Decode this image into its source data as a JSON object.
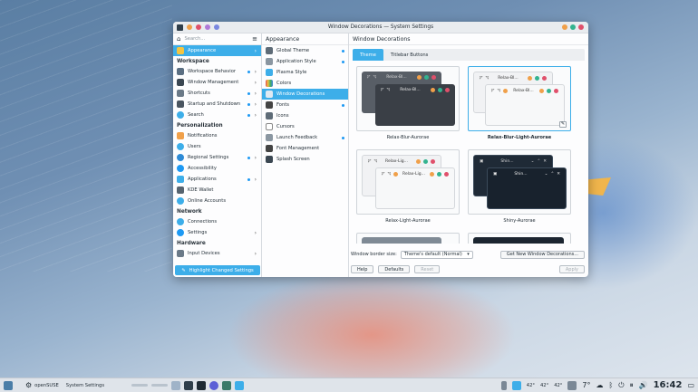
{
  "window": {
    "title": "Window Decorations — System Settings"
  },
  "sidebar": {
    "search_placeholder": "Search...",
    "items": [
      {
        "label": "Appearance"
      },
      {
        "label": "Workspace Behavior"
      },
      {
        "label": "Window Management"
      },
      {
        "label": "Shortcuts"
      },
      {
        "label": "Startup and Shutdown"
      },
      {
        "label": "Search"
      },
      {
        "label": "Notifications"
      },
      {
        "label": "Users"
      },
      {
        "label": "Regional Settings"
      },
      {
        "label": "Accessibility"
      },
      {
        "label": "Applications"
      },
      {
        "label": "KDE Wallet"
      },
      {
        "label": "Online Accounts"
      },
      {
        "label": "Connections"
      },
      {
        "label": "Settings"
      },
      {
        "label": "Input Devices"
      }
    ],
    "categories": [
      "Workspace",
      "Personalization",
      "Network",
      "Hardware"
    ],
    "footer_label": "Highlight Changed Settings"
  },
  "middle": {
    "header": "Appearance",
    "items": [
      {
        "label": "Global Theme"
      },
      {
        "label": "Application Style"
      },
      {
        "label": "Plasma Style"
      },
      {
        "label": "Colors"
      },
      {
        "label": "Window Decorations"
      },
      {
        "label": "Fonts"
      },
      {
        "label": "Icons"
      },
      {
        "label": "Cursors"
      },
      {
        "label": "Launch Feedback"
      },
      {
        "label": "Font Management"
      },
      {
        "label": "Splash Screen"
      }
    ]
  },
  "content": {
    "header": "Window Decorations",
    "tabs": [
      "Theme",
      "Titlebar Buttons"
    ],
    "themes": [
      {
        "name": "Relax-Blur-Aurorae",
        "preview_title": "Relax-Bl..."
      },
      {
        "name": "Relax-Blur-Light-Aurorae",
        "preview_title": "Relax-Bl..."
      },
      {
        "name": "Relax-Light-Aurorae",
        "preview_title": "Relax-Lig..."
      },
      {
        "name": "Shiny-Aurorae",
        "preview_title": "Shin..."
      }
    ],
    "border_size_label": "Window border size:",
    "border_size_value": "Theme's default (Normal)",
    "get_new_label": "Get New Window Decorations...",
    "help_label": "Help",
    "defaults_label": "Defaults",
    "reset_label": "Reset",
    "apply_label": "Apply"
  },
  "taskbar": {
    "distro": "openSUSE",
    "active_app": "System Settings",
    "temps": [
      "42°",
      "42°",
      "42°"
    ],
    "weather": "7°",
    "clock": "16:42"
  },
  "colors": {
    "accent": "#3daee9",
    "close_dot": "#e0506b",
    "max_dot": "#33b38f",
    "min_dot": "#f0a04a"
  }
}
